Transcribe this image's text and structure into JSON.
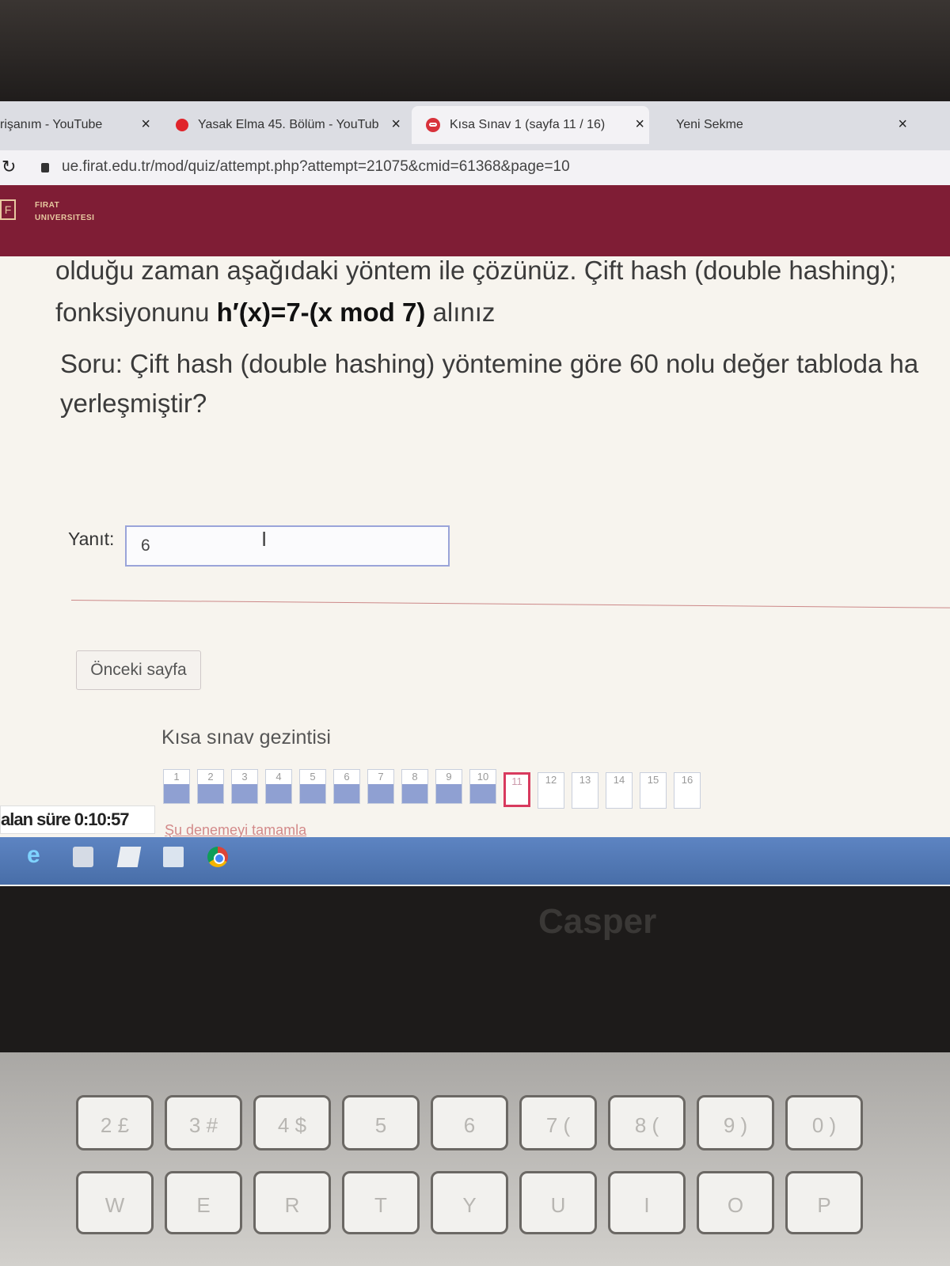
{
  "browser": {
    "tabs": [
      {
        "title": "rişanım - YouTube",
        "icon": "youtube-icon"
      },
      {
        "title": "Yasak Elma 45. Bölüm - YouTub",
        "icon": "youtube-icon"
      },
      {
        "title": "Kısa Sınav 1 (sayfa 11 / 16)",
        "icon": "quiz-icon",
        "active": true
      },
      {
        "title": "Yeni Sekme",
        "icon": "none"
      }
    ],
    "close_glyph": "×",
    "url": "ue.firat.edu.tr/mod/quiz/attempt.php?attempt=21075&cmid=61368&page=10"
  },
  "site": {
    "logo_line1": "FIRAT",
    "logo_line2": "UNIVERSITESI"
  },
  "question": {
    "line1": "olduğu zaman aşağıdaki yöntem ile çözünüz. Çift hash  (double hashing);",
    "line2_prefix": "fonksiyonunu ",
    "line2_formula": "h′(x)=7-(x mod 7)",
    "line2_suffix": " alınız",
    "line3": "Soru: Çift hash  (double hashing) yöntemine göre 60 nolu değer tabloda ha",
    "line4": "yerleşmiştir?"
  },
  "answer": {
    "label": "Yanıt:",
    "value": "6"
  },
  "navigation": {
    "prev_button": "Önceki sayfa",
    "title": "Kısa sınav gezintisi",
    "questions": [
      {
        "n": "1",
        "state": "answered"
      },
      {
        "n": "2",
        "state": "answered"
      },
      {
        "n": "3",
        "state": "answered"
      },
      {
        "n": "4",
        "state": "answered"
      },
      {
        "n": "5",
        "state": "answered"
      },
      {
        "n": "6",
        "state": "answered"
      },
      {
        "n": "7",
        "state": "answered"
      },
      {
        "n": "8",
        "state": "answered"
      },
      {
        "n": "9",
        "state": "answered"
      },
      {
        "n": "10",
        "state": "answered"
      },
      {
        "n": "11",
        "state": "current"
      },
      {
        "n": "12",
        "state": "empty"
      },
      {
        "n": "13",
        "state": "empty"
      },
      {
        "n": "14",
        "state": "empty"
      },
      {
        "n": "15",
        "state": "empty"
      },
      {
        "n": "16",
        "state": "empty"
      }
    ],
    "finish_link": "Şu denemeyi tamamla",
    "timer": "alan süre 0:10:57"
  },
  "laptop": {
    "brand": "Casper",
    "keys_row2": [
      "2 £",
      "3 #",
      "4 $",
      "5",
      "6",
      "7 (",
      "8 (",
      "9 )",
      "0 )"
    ],
    "keys_row3": [
      "W",
      "E",
      "R",
      "T",
      "Y",
      "U",
      "I",
      "O",
      "P"
    ]
  }
}
